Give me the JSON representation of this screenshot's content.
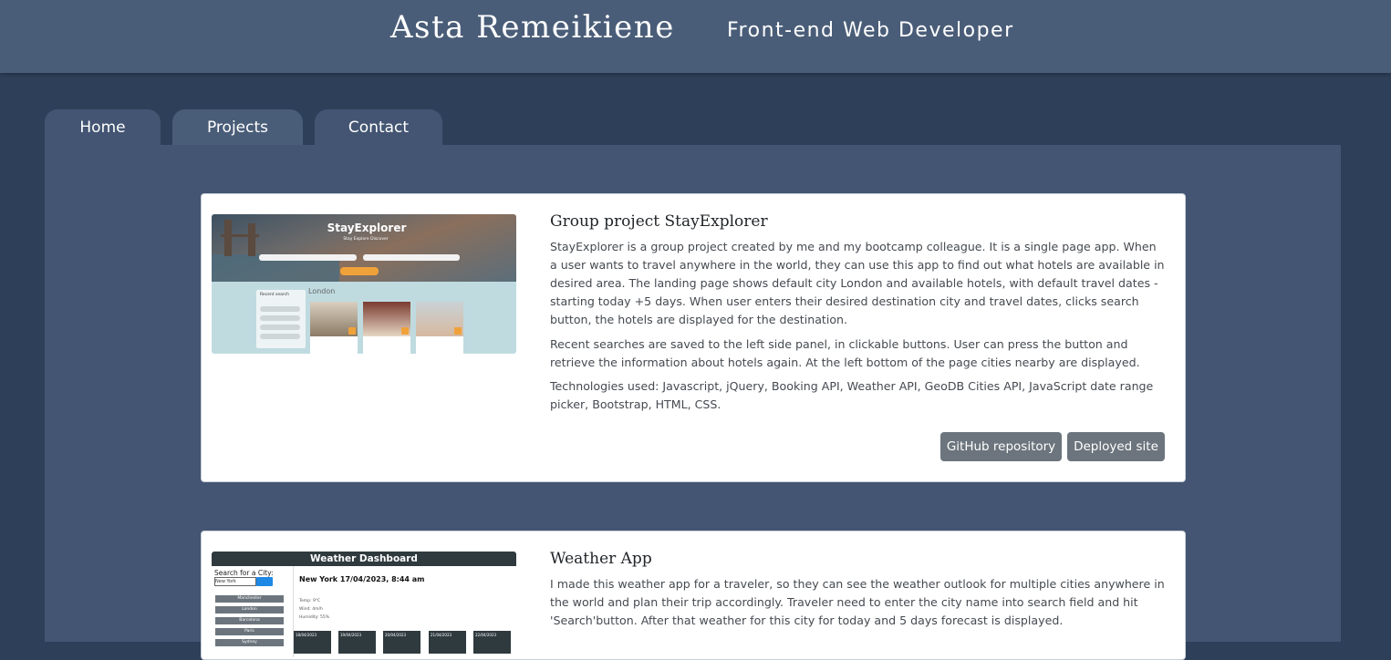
{
  "header": {
    "name": "Asta Remeikiene",
    "role": "Front-end Web Developer"
  },
  "nav": {
    "tabs": [
      "Home",
      "Projects",
      "Contact"
    ],
    "active": "Projects"
  },
  "projects": [
    {
      "title": "Group project StayExplorer",
      "paragraphs": [
        "StayExplorer is a group project created by me and my bootcamp colleague. It is a single page app. When a user wants to travel anywhere in the world, they can use this app to find out what hotels are available in desired area. The landing page shows default city London and available hotels, with default travel dates - starting today +5 days. When user enters their desired destination city and travel dates, clicks search button, the hotels are displayed for the destination.",
        "Recent searches are saved to the left side panel, in clickable buttons. User can press the button and retrieve the information about hotels again. At the left bottom of the page cities nearby are displayed.",
        "Technologies used: Javascript, jQuery, Booking API, Weather API, GeoDB Cities API, JavaScript date range picker, Bootstrap, HTML, CSS."
      ],
      "buttons": [
        "GitHub repository",
        "Deployed site"
      ],
      "screenshot": {
        "logo": "StayExplorer",
        "nav": "Stay    Explore    Discover",
        "recent_heading": "Recent search",
        "city": "London"
      }
    },
    {
      "title": "Weather App",
      "paragraphs": [
        "I made this weather app for a traveler, so they can see the weather outlook for multiple cities anywhere in the world and plan their trip accordingly. Traveler need to enter the city name into search field and hit 'Search'button. After that weather for this city for today and 5 days forecast is displayed."
      ],
      "screenshot": {
        "header": "Weather Dashboard",
        "search_label": "Search for a City:",
        "input_value": "New York",
        "cities": [
          "Manchester",
          "London",
          "Barcelona",
          "Paris",
          "Sydney"
        ],
        "current": "New York 17/04/2023, 8:44 am",
        "details": [
          "Temp: 9°C",
          "Wind: 4m/h",
          "Humidity: 55%"
        ],
        "forecast_dates": [
          "18/04/2023",
          "19/04/2023",
          "20/04/2023",
          "21/04/2023",
          "22/04/2023"
        ]
      }
    }
  ],
  "colors": {
    "page_bg": "#2e4059",
    "header_bg": "#4a5d78",
    "panel_bg": "#435572",
    "button_bg": "#6c757d"
  }
}
